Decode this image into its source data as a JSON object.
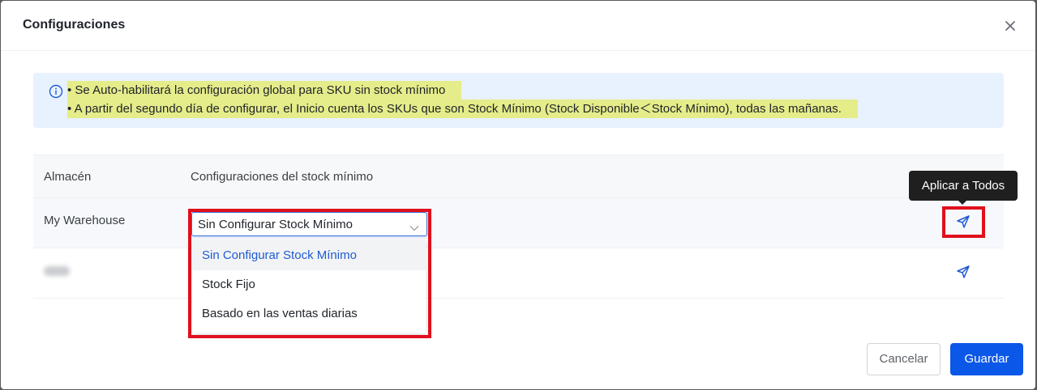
{
  "dialog": {
    "title": "Configuraciones",
    "close_icon": "close-icon"
  },
  "alert": {
    "icon": "info-icon",
    "lines": [
      "• Se Auto-habilitará la configuración global para SKU sin stock mínimo",
      "• A partir del segundo día de configurar, el Inicio cuenta los SKUs que son Stock Mínimo (Stock Disponible＜Stock Mínimo), todas las mañanas."
    ]
  },
  "table": {
    "columns": [
      "Almacén",
      "Configuraciones del stock mínimo"
    ],
    "rows": [
      {
        "warehouse": "My Warehouse",
        "setting": "Sin Configurar Stock Mínimo"
      },
      {
        "warehouse": "",
        "setting": ""
      }
    ]
  },
  "dropdown": {
    "options": [
      "Sin Configurar Stock Mínimo",
      "Stock Fijo",
      "Basado en las ventas diarias"
    ],
    "selected_index": 0
  },
  "tooltip": {
    "text": "Aplicar a Todos"
  },
  "footer": {
    "cancel_label": "Cancelar",
    "save_label": "Guardar"
  },
  "colors": {
    "primary": "#0b57e8",
    "highlight_red": "#e0101c",
    "alert_bg": "#e8f2fe",
    "text_highlight": "#e5ec8a"
  }
}
